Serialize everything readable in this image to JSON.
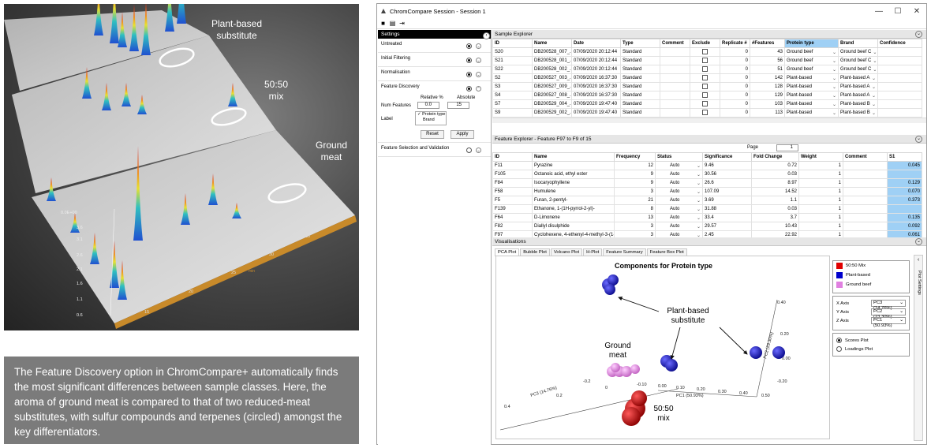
{
  "chrom_panel": {
    "labels": {
      "plant_based": "Plant-based\nsubstitute",
      "mix": "50:50\nmix",
      "ground_meat": "Ground\nmeat"
    },
    "y_ticks": [
      "0.0E+00",
      "3.6",
      "3.1",
      "2.6",
      "2.1",
      "1.6",
      "1.1",
      "0.6"
    ],
    "x_ticks": [
      "15",
      "20",
      "25",
      "30",
      "35",
      "40"
    ],
    "x_axis_unit": "min"
  },
  "caption": "The Feature Discovery option in ChromCompare+ automatically finds the most significant differences between sample classes. Here, the aroma of ground meat is compared to that of two reduced-meat substitutes, with sulfur compounds and terpenes (circled) amongst the key differentiators.",
  "window": {
    "title": "ChromCompare Session - Session 1",
    "controls": [
      "—",
      "☐",
      "✕"
    ]
  },
  "settings": {
    "title": "Settings",
    "items": [
      {
        "label": "Untreated"
      },
      {
        "label": "Initial Filtering"
      },
      {
        "label": "Normalisation"
      },
      {
        "label": "Feature Discovery"
      }
    ],
    "num_features_label": "Num Features",
    "relative_label": "Relative %",
    "absolute_label": "Absolute",
    "relative_value": "0.0",
    "absolute_value": "15",
    "label_label": "Label",
    "label_options": [
      "Protein type",
      "Brand"
    ],
    "reset": "Reset",
    "apply": "Apply",
    "selection_label": "Feature Selection and Validation"
  },
  "sample_explorer": {
    "title": "Sample Explorer",
    "columns": [
      "ID",
      "Name",
      "Date",
      "Type",
      "Comment",
      "Exclude",
      "Replicate #",
      "#Features",
      "Protein type",
      "Brand",
      "Confidence"
    ],
    "rows": [
      [
        "S20",
        "DB200528_007_...",
        "07/09/2020 20:12:44",
        "Standard",
        "",
        "",
        "0",
        "43",
        "Ground beef",
        "Ground beef C"
      ],
      [
        "S21",
        "DB200528_001_...",
        "07/09/2020 20:12:44",
        "Standard",
        "",
        "",
        "0",
        "56",
        "Ground beef",
        "Ground beef C"
      ],
      [
        "S22",
        "DB200528_002_...",
        "07/09/2020 20:12:44",
        "Standard",
        "",
        "",
        "0",
        "51",
        "Ground beef",
        "Ground beef C"
      ],
      [
        "S2",
        "DB200527_003_...",
        "07/09/2020 16:37:30",
        "Standard",
        "",
        "",
        "0",
        "142",
        "Plant-based",
        "Plant-based A"
      ],
      [
        "S3",
        "DB200527_009_...",
        "07/09/2020 16:37:30",
        "Standard",
        "",
        "",
        "0",
        "128",
        "Plant-based",
        "Plant-based A"
      ],
      [
        "S4",
        "DB200527_008_...",
        "07/09/2020 16:37:30",
        "Standard",
        "",
        "",
        "0",
        "129",
        "Plant-based",
        "Plant-based A"
      ],
      [
        "S7",
        "DB200529_004_...",
        "07/09/2020 19:47:40",
        "Standard",
        "",
        "",
        "0",
        "103",
        "Plant-based",
        "Plant-based B"
      ],
      [
        "S9",
        "DB200529_002_...",
        "07/09/2020 19:47:40",
        "Standard",
        "",
        "",
        "0",
        "113",
        "Plant-based",
        "Plant-based B"
      ]
    ]
  },
  "feature_explorer": {
    "title": "Feature Explorer - Feature F97 to F9 of 15",
    "page_label": "Page",
    "page_value": "1",
    "columns": [
      "ID",
      "Name",
      "Frequency",
      "Status",
      "Significance",
      "Fold Change",
      "Weight",
      "Comment",
      "S1"
    ],
    "rows": [
      [
        "F11",
        "Pyrazine",
        "12",
        "Auto",
        "9.46",
        "0.72",
        "1",
        "",
        "0.045"
      ],
      [
        "F105",
        "Octanoic acid, ethyl ester",
        "9",
        "Auto",
        "30.56",
        "0.03",
        "1",
        "",
        ""
      ],
      [
        "F84",
        "Isocaryophyllene",
        "9",
        "Auto",
        "26.6",
        "8.97",
        "1",
        "",
        "0.129"
      ],
      [
        "F58",
        "Humulene",
        "3",
        "Auto",
        "107.09",
        "14.52",
        "1",
        "",
        "0.070"
      ],
      [
        "F5",
        "Furan, 2-pentyl-",
        "21",
        "Auto",
        "3.69",
        "1.1",
        "1",
        "",
        "0.373"
      ],
      [
        "F139",
        "Ethanone, 1-(1H-pyrrol-2-yl)-",
        "8",
        "Auto",
        "31.88",
        "0.03",
        "1",
        "",
        ""
      ],
      [
        "F64",
        "D-Limonene",
        "13",
        "Auto",
        "33.4",
        "3.7",
        "1",
        "",
        "0.135"
      ],
      [
        "F82",
        "Diallyl disulphide",
        "3",
        "Auto",
        "29.57",
        "10.43",
        "1",
        "",
        "0.092"
      ],
      [
        "F97",
        "Cyclohexene, 4-ethenyl-4-methyl-3-(1-met...",
        "3",
        "Auto",
        "2.45",
        "22.92",
        "1",
        "",
        "0.061"
      ]
    ]
  },
  "visualisations": {
    "title": "Visualisations",
    "tabs": [
      "PCA Plot",
      "Bubble Plot",
      "Volcano Plot",
      "H-Plot",
      "Feature Summary",
      "Feature Box Plot"
    ],
    "plot_title": "Components for Protein type",
    "annotations": {
      "plant_based": "Plant-based\nsubstitute",
      "ground_meat": "Ground\nmeat",
      "mix": "50:50\nmix"
    },
    "axis_labels": {
      "x": "PC1 (50.93%)",
      "y": "PC2 (23.30%)",
      "z": "PC3 (14.76%)"
    },
    "x_ticks": [
      "-0.10",
      "0.00",
      "0.10",
      "0.20",
      "0.30",
      "0.40",
      "0.50"
    ],
    "y_ticks": [
      "0.40",
      "0.20",
      "0.00",
      "-0.20"
    ],
    "z_ticks": [
      "-0.2",
      "0",
      "0.2",
      "0.4"
    ],
    "legend": [
      {
        "label": "50:50 Mix",
        "color": "#e00000"
      },
      {
        "label": "Plant-based",
        "color": "#0000cc"
      },
      {
        "label": "Ground beef",
        "color": "#e080e0"
      }
    ],
    "axes": [
      {
        "label": "X Axis",
        "value": "PC3 (14.76%)"
      },
      {
        "label": "Y Axis",
        "value": "PC2 (23.30%)"
      },
      {
        "label": "Z Axis",
        "value": "PC1 (50.93%)"
      }
    ],
    "plot_options": [
      "Scores Plot",
      "Loadings Plot"
    ],
    "side_label": "Plot Settings"
  }
}
